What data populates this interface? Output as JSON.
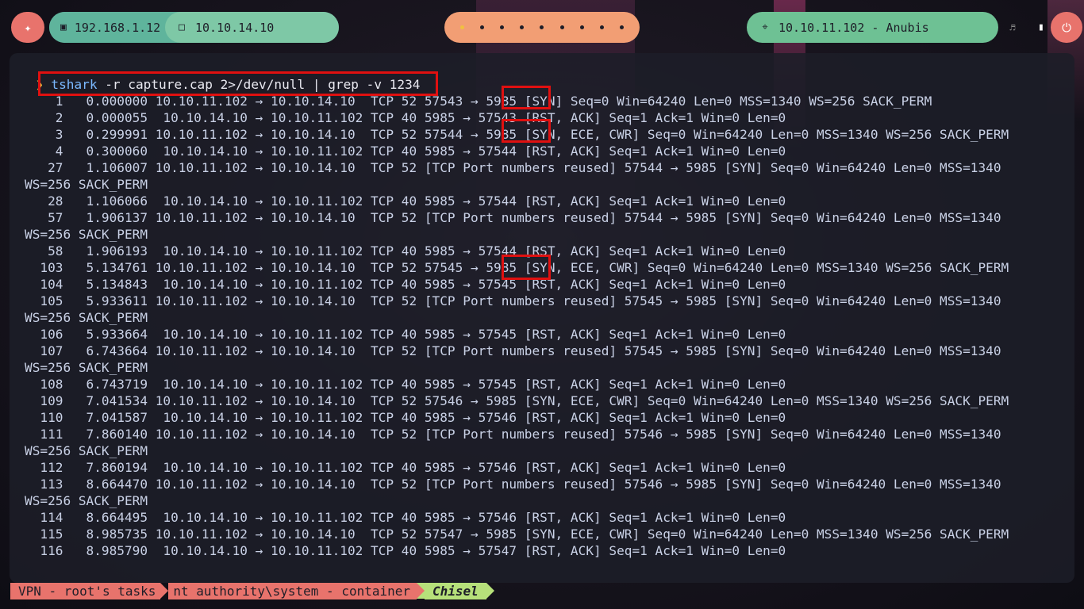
{
  "topbar": {
    "local_ip": "192.168.1.12",
    "vpn_ip": "10.10.14.10",
    "target": "10.10.11.102 - Anubis"
  },
  "terminal": {
    "prompt_symbol": "❯",
    "command": "tshark",
    "command_args": " -r capture.cap 2>/dev/null | grep -v 1234",
    "lines": [
      "    1   0.000000 10.10.11.102 → 10.10.14.10  TCP 52 57543 → 5985 [SYN] Seq=0 Win=64240 Len=0 MSS=1340 WS=256 SACK_PERM",
      "    2   0.000055  10.10.14.10 → 10.10.11.102 TCP 40 5985 → 57543 [RST, ACK] Seq=1 Ack=1 Win=0 Len=0",
      "    3   0.299991 10.10.11.102 → 10.10.14.10  TCP 52 57544 → 5985 [SYN, ECE, CWR] Seq=0 Win=64240 Len=0 MSS=1340 WS=256 SACK_PERM",
      "    4   0.300060  10.10.14.10 → 10.10.11.102 TCP 40 5985 → 57544 [RST, ACK] Seq=1 Ack=1 Win=0 Len=0",
      "   27   1.106007 10.10.11.102 → 10.10.14.10  TCP 52 [TCP Port numbers reused] 57544 → 5985 [SYN] Seq=0 Win=64240 Len=0 MSS=1340",
      "WS=256 SACK_PERM",
      "   28   1.106066  10.10.14.10 → 10.10.11.102 TCP 40 5985 → 57544 [RST, ACK] Seq=1 Ack=1 Win=0 Len=0",
      "   57   1.906137 10.10.11.102 → 10.10.14.10  TCP 52 [TCP Port numbers reused] 57544 → 5985 [SYN] Seq=0 Win=64240 Len=0 MSS=1340",
      "WS=256 SACK_PERM",
      "   58   1.906193  10.10.14.10 → 10.10.11.102 TCP 40 5985 → 57544 [RST, ACK] Seq=1 Ack=1 Win=0 Len=0",
      "  103   5.134761 10.10.11.102 → 10.10.14.10  TCP 52 57545 → 5985 [SYN, ECE, CWR] Seq=0 Win=64240 Len=0 MSS=1340 WS=256 SACK_PERM",
      "  104   5.134843  10.10.14.10 → 10.10.11.102 TCP 40 5985 → 57545 [RST, ACK] Seq=1 Ack=1 Win=0 Len=0",
      "  105   5.933611 10.10.11.102 → 10.10.14.10  TCP 52 [TCP Port numbers reused] 57545 → 5985 [SYN] Seq=0 Win=64240 Len=0 MSS=1340",
      "WS=256 SACK_PERM",
      "  106   5.933664  10.10.14.10 → 10.10.11.102 TCP 40 5985 → 57545 [RST, ACK] Seq=1 Ack=1 Win=0 Len=0",
      "  107   6.743664 10.10.11.102 → 10.10.14.10  TCP 52 [TCP Port numbers reused] 57545 → 5985 [SYN] Seq=0 Win=64240 Len=0 MSS=1340",
      "WS=256 SACK_PERM",
      "  108   6.743719  10.10.14.10 → 10.10.11.102 TCP 40 5985 → 57545 [RST, ACK] Seq=1 Ack=1 Win=0 Len=0",
      "  109   7.041534 10.10.11.102 → 10.10.14.10  TCP 52 57546 → 5985 [SYN, ECE, CWR] Seq=0 Win=64240 Len=0 MSS=1340 WS=256 SACK_PERM",
      "  110   7.041587  10.10.14.10 → 10.10.11.102 TCP 40 5985 → 57546 [RST, ACK] Seq=1 Ack=1 Win=0 Len=0",
      "  111   7.860140 10.10.11.102 → 10.10.14.10  TCP 52 [TCP Port numbers reused] 57546 → 5985 [SYN] Seq=0 Win=64240 Len=0 MSS=1340",
      "WS=256 SACK_PERM",
      "  112   7.860194  10.10.14.10 → 10.10.11.102 TCP 40 5985 → 57546 [RST, ACK] Seq=1 Ack=1 Win=0 Len=0",
      "  113   8.664470 10.10.11.102 → 10.10.14.10  TCP 52 [TCP Port numbers reused] 57546 → 5985 [SYN] Seq=0 Win=64240 Len=0 MSS=1340",
      "WS=256 SACK_PERM",
      "  114   8.664495  10.10.14.10 → 10.10.11.102 TCP 40 5985 → 57546 [RST, ACK] Seq=1 Ack=1 Win=0 Len=0",
      "  115   8.985735 10.10.11.102 → 10.10.14.10  TCP 52 57547 → 5985 [SYN, ECE, CWR] Seq=0 Win=64240 Len=0 MSS=1340 WS=256 SACK_PERM",
      "  116   8.985790  10.10.14.10 → 10.10.11.102 TCP 40 5985 → 57547 [RST, ACK] Seq=1 Ack=1 Win=0 Len=0"
    ]
  },
  "statusbar": {
    "segment1": "VPN - root's tasks",
    "segment2": "nt authority\\system - container",
    "segment3": "Chisel"
  },
  "colors": {
    "accent_red": "#e8736c",
    "accent_green": "#6ec194",
    "accent_orange": "#f29e74",
    "highlight_box": "#e01010"
  }
}
